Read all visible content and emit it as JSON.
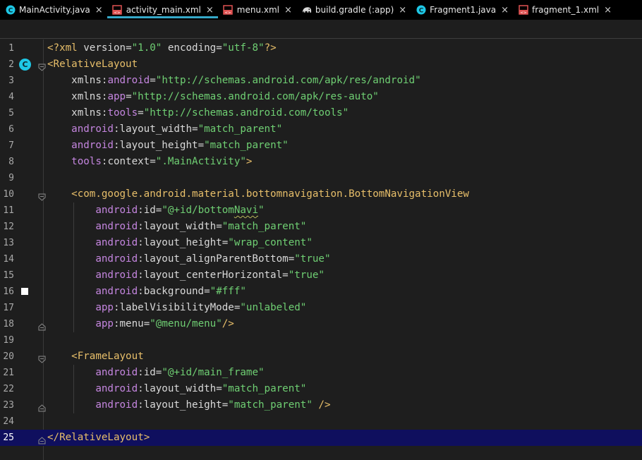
{
  "tabs": [
    {
      "label": "MainActivity.java",
      "icon": "java-class-icon",
      "active": false
    },
    {
      "label": "activity_main.xml",
      "icon": "xml-layout-icon",
      "active": true
    },
    {
      "label": "menu.xml",
      "icon": "xml-layout-icon",
      "active": false
    },
    {
      "label": "build.gradle (:app)",
      "icon": "gradle-elephant-icon",
      "active": false
    },
    {
      "label": "Fragment1.java",
      "icon": "java-class-icon",
      "active": false
    },
    {
      "label": "fragment_1.xml",
      "icon": "xml-layout-icon",
      "active": false
    }
  ],
  "tab_close_glyph": "×",
  "current_line": 25,
  "colors": {
    "accent_tab_underline": "#35a8c8",
    "current_line_bg": "#0f0f5e",
    "tag": "#e8bf6a",
    "namespace": "#c586e0",
    "string_value": "#6fcf73",
    "class_badge": "#1ec8e6"
  },
  "gutter_markers": {
    "line_2": {
      "icon": "class-badge-icon",
      "text": "C"
    },
    "line_16": {
      "icon": "color-swatch-icon",
      "color": "#ffffff"
    }
  },
  "lines": [
    {
      "n": "1",
      "tokens": [
        [
          "t-punct",
          "<?"
        ],
        [
          "t-tag",
          "xml "
        ],
        [
          "t-attr",
          "version"
        ],
        [
          "t-plain",
          "="
        ],
        [
          "t-val",
          "\"1.0\""
        ],
        [
          "t-plain",
          " "
        ],
        [
          "t-attr",
          "encoding"
        ],
        [
          "t-plain",
          "="
        ],
        [
          "t-val",
          "\"utf-8\""
        ],
        [
          "t-punct",
          "?>"
        ]
      ]
    },
    {
      "n": "2",
      "tokens": [
        [
          "t-punct",
          "<"
        ],
        [
          "t-tag",
          "RelativeLayout"
        ]
      ]
    },
    {
      "n": "3",
      "tokens": [
        [
          "t-plain",
          "    "
        ],
        [
          "t-attr",
          "xmlns"
        ],
        [
          "t-plain",
          ":"
        ],
        [
          "t-ns",
          "android"
        ],
        [
          "t-plain",
          "="
        ],
        [
          "t-val",
          "\"http://schemas.android.com/apk/res/android\""
        ]
      ]
    },
    {
      "n": "4",
      "tokens": [
        [
          "t-plain",
          "    "
        ],
        [
          "t-attr",
          "xmlns"
        ],
        [
          "t-plain",
          ":"
        ],
        [
          "t-ns",
          "app"
        ],
        [
          "t-plain",
          "="
        ],
        [
          "t-val",
          "\"http://schemas.android.com/apk/res-auto\""
        ]
      ]
    },
    {
      "n": "5",
      "tokens": [
        [
          "t-plain",
          "    "
        ],
        [
          "t-attr",
          "xmlns"
        ],
        [
          "t-plain",
          ":"
        ],
        [
          "t-ns",
          "tools"
        ],
        [
          "t-plain",
          "="
        ],
        [
          "t-val",
          "\"http://schemas.android.com/tools\""
        ]
      ]
    },
    {
      "n": "6",
      "tokens": [
        [
          "t-plain",
          "    "
        ],
        [
          "t-ns",
          "android"
        ],
        [
          "t-plain",
          ":"
        ],
        [
          "t-attr",
          "layout_width"
        ],
        [
          "t-plain",
          "="
        ],
        [
          "t-val",
          "\"match_parent\""
        ]
      ]
    },
    {
      "n": "7",
      "tokens": [
        [
          "t-plain",
          "    "
        ],
        [
          "t-ns",
          "android"
        ],
        [
          "t-plain",
          ":"
        ],
        [
          "t-attr",
          "layout_height"
        ],
        [
          "t-plain",
          "="
        ],
        [
          "t-val",
          "\"match_parent\""
        ]
      ]
    },
    {
      "n": "8",
      "tokens": [
        [
          "t-plain",
          "    "
        ],
        [
          "t-ns",
          "tools"
        ],
        [
          "t-plain",
          ":"
        ],
        [
          "t-attr",
          "context"
        ],
        [
          "t-plain",
          "="
        ],
        [
          "t-val",
          "\".MainActivity\""
        ],
        [
          "t-punct",
          ">"
        ]
      ]
    },
    {
      "n": "9",
      "tokens": []
    },
    {
      "n": "10",
      "tokens": [
        [
          "t-plain",
          "    "
        ],
        [
          "t-punct",
          "<"
        ],
        [
          "t-tag",
          "com.google.android.material.bottomnavigation.BottomNavigationView"
        ]
      ]
    },
    {
      "n": "11",
      "tokens": [
        [
          "t-plain",
          "        "
        ],
        [
          "t-ns",
          "android"
        ],
        [
          "t-plain",
          ":"
        ],
        [
          "t-attr",
          "id"
        ],
        [
          "t-plain",
          "="
        ],
        [
          "t-val",
          "\"@+id/bottom"
        ],
        [
          "t-val squiggle",
          "Navi"
        ],
        [
          "t-val",
          "\""
        ]
      ]
    },
    {
      "n": "12",
      "tokens": [
        [
          "t-plain",
          "        "
        ],
        [
          "t-ns",
          "android"
        ],
        [
          "t-plain",
          ":"
        ],
        [
          "t-attr",
          "layout_width"
        ],
        [
          "t-plain",
          "="
        ],
        [
          "t-val",
          "\"match_parent\""
        ]
      ]
    },
    {
      "n": "13",
      "tokens": [
        [
          "t-plain",
          "        "
        ],
        [
          "t-ns",
          "android"
        ],
        [
          "t-plain",
          ":"
        ],
        [
          "t-attr",
          "layout_height"
        ],
        [
          "t-plain",
          "="
        ],
        [
          "t-val",
          "\"wrap_content\""
        ]
      ]
    },
    {
      "n": "14",
      "tokens": [
        [
          "t-plain",
          "        "
        ],
        [
          "t-ns",
          "android"
        ],
        [
          "t-plain",
          ":"
        ],
        [
          "t-attr",
          "layout_alignParentBottom"
        ],
        [
          "t-plain",
          "="
        ],
        [
          "t-val",
          "\"true\""
        ]
      ]
    },
    {
      "n": "15",
      "tokens": [
        [
          "t-plain",
          "        "
        ],
        [
          "t-ns",
          "android"
        ],
        [
          "t-plain",
          ":"
        ],
        [
          "t-attr",
          "layout_centerHorizontal"
        ],
        [
          "t-plain",
          "="
        ],
        [
          "t-val",
          "\"true\""
        ]
      ]
    },
    {
      "n": "16",
      "tokens": [
        [
          "t-plain",
          "        "
        ],
        [
          "t-ns",
          "android"
        ],
        [
          "t-plain",
          ":"
        ],
        [
          "t-attr",
          "background"
        ],
        [
          "t-plain",
          "="
        ],
        [
          "t-val",
          "\"#fff\""
        ]
      ]
    },
    {
      "n": "17",
      "tokens": [
        [
          "t-plain",
          "        "
        ],
        [
          "t-ns",
          "app"
        ],
        [
          "t-plain",
          ":"
        ],
        [
          "t-attr",
          "labelVisibilityMode"
        ],
        [
          "t-plain",
          "="
        ],
        [
          "t-val",
          "\"unlabeled\""
        ]
      ]
    },
    {
      "n": "18",
      "tokens": [
        [
          "t-plain",
          "        "
        ],
        [
          "t-ns",
          "app"
        ],
        [
          "t-plain",
          ":"
        ],
        [
          "t-attr",
          "menu"
        ],
        [
          "t-plain",
          "="
        ],
        [
          "t-val",
          "\"@menu/menu\""
        ],
        [
          "t-punct",
          "/>"
        ]
      ]
    },
    {
      "n": "19",
      "tokens": []
    },
    {
      "n": "20",
      "tokens": [
        [
          "t-plain",
          "    "
        ],
        [
          "t-punct",
          "<"
        ],
        [
          "t-tag",
          "FrameLayout"
        ]
      ]
    },
    {
      "n": "21",
      "tokens": [
        [
          "t-plain",
          "        "
        ],
        [
          "t-ns",
          "android"
        ],
        [
          "t-plain",
          ":"
        ],
        [
          "t-attr",
          "id"
        ],
        [
          "t-plain",
          "="
        ],
        [
          "t-val",
          "\"@+id/main_frame\""
        ]
      ]
    },
    {
      "n": "22",
      "tokens": [
        [
          "t-plain",
          "        "
        ],
        [
          "t-ns",
          "android"
        ],
        [
          "t-plain",
          ":"
        ],
        [
          "t-attr",
          "layout_width"
        ],
        [
          "t-plain",
          "="
        ],
        [
          "t-val",
          "\"match_parent\""
        ]
      ]
    },
    {
      "n": "23",
      "tokens": [
        [
          "t-plain",
          "        "
        ],
        [
          "t-ns",
          "android"
        ],
        [
          "t-plain",
          ":"
        ],
        [
          "t-attr",
          "layout_height"
        ],
        [
          "t-plain",
          "="
        ],
        [
          "t-val",
          "\"match_parent\""
        ],
        [
          "t-plain",
          " "
        ],
        [
          "t-punct",
          "/>"
        ]
      ]
    },
    {
      "n": "24",
      "tokens": []
    },
    {
      "n": "25",
      "tokens": [
        [
          "t-punct",
          "</"
        ],
        [
          "t-tag",
          "RelativeLayout"
        ],
        [
          "t-punct",
          ">"
        ]
      ]
    }
  ]
}
